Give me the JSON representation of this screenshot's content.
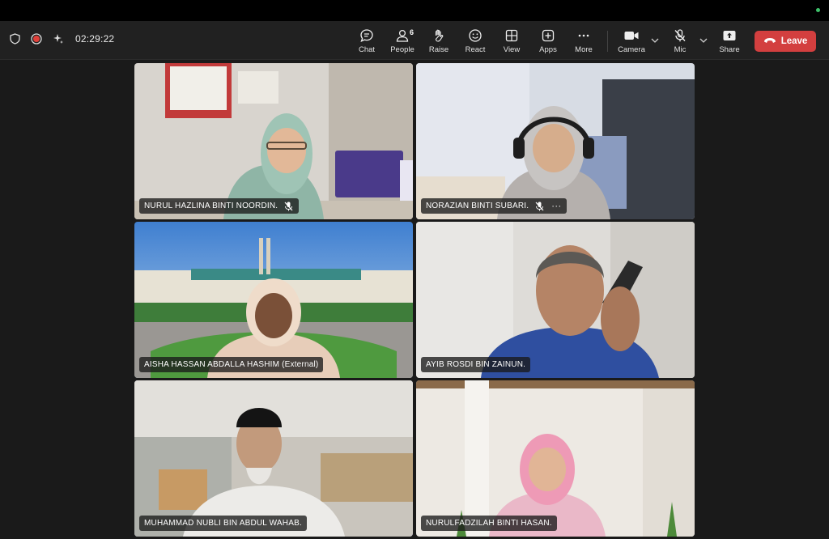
{
  "window": {
    "timer": "02:29:22"
  },
  "toolbar": {
    "chat": "Chat",
    "people": "People",
    "people_count": "6",
    "raise": "Raise",
    "react": "React",
    "view": "View",
    "apps": "Apps",
    "more": "More",
    "camera": "Camera",
    "mic": "Mic",
    "share": "Share",
    "leave": "Leave"
  },
  "participants": [
    {
      "name": "NURUL HAZLINA BINTI NOORDIN.",
      "muted": true
    },
    {
      "name": "NORAZIAN BINTI SUBARI.",
      "muted": true,
      "more": "···"
    },
    {
      "name": "AISHA HASSAN ABDALLA HASHIM (External)",
      "muted": false
    },
    {
      "name": "AYIB ROSDI BIN ZAINUN.",
      "muted": false
    },
    {
      "name": "MUHAMMAD NUBLI BIN ABDUL WAHAB.",
      "muted": false,
      "active_speaker": true
    },
    {
      "name": "NURULFADZILAH BINTI HASAN.",
      "muted": false
    }
  ],
  "colors": {
    "leave": "#d33f3f",
    "active_outline": "#8c8cf5",
    "toolbar_bg": "#212121",
    "stage_bg": "#1a1a1a"
  }
}
